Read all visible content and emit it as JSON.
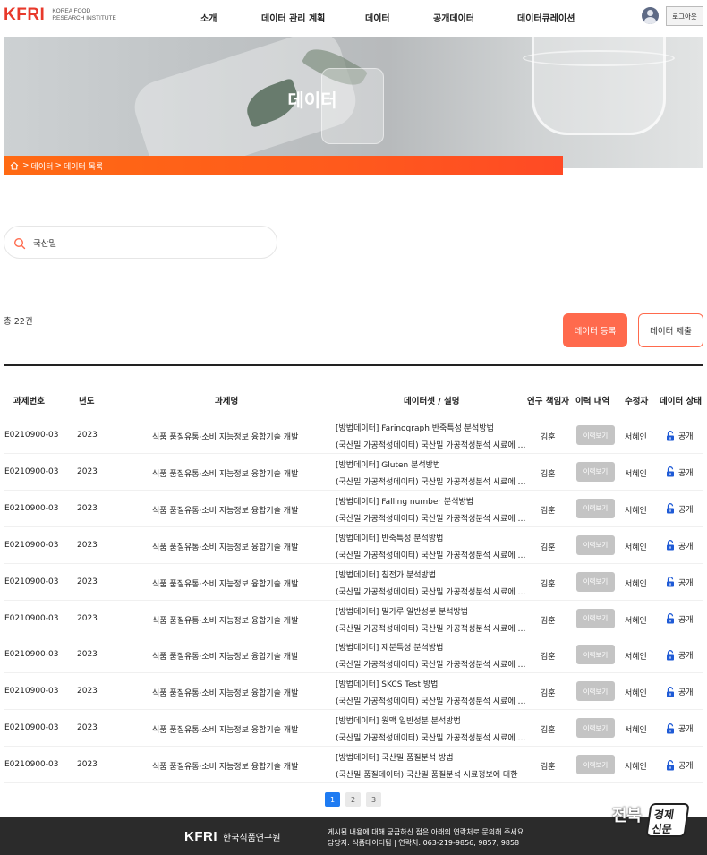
{
  "header": {
    "logo_mark": "KFRI",
    "logo_sub_line1": "KOREA FOOD",
    "logo_sub_line2": "RESEARCH INSTITUTE",
    "nav": [
      "소개",
      "데이터 관리 계획",
      "데이터",
      "공개데이터",
      "데이터큐레이션"
    ],
    "logout_label": "로그아웃"
  },
  "hero": {
    "title": "데이터",
    "breadcrumb": [
      "데이터",
      "데이터 목록"
    ]
  },
  "search": {
    "value": "국산밀",
    "placeholder": ""
  },
  "list": {
    "total": "총 22건",
    "register_label": "데이터 등록",
    "submit_label": "데이터 제출"
  },
  "table": {
    "headers": [
      "과제번호",
      "년도",
      "과제명",
      "데이터셋 / 설명",
      "연구 책임자",
      "이력 내역",
      "수정자",
      "데이터 상태"
    ],
    "history_button": "이력보기",
    "rows": [
      {
        "id": "E0210900-03",
        "year": "2023",
        "project": "식품 품질유통·소비 지능정보 융합기술 개발",
        "title": "[방법데이터] Farinograph 반죽특성 분석방법",
        "desc": "(국산밀 가공적성데이터) 국산밀 가공적성분석 시료에 대한",
        "lead": "김훈",
        "modifier": "서혜인",
        "status": "공개"
      },
      {
        "id": "E0210900-03",
        "year": "2023",
        "project": "식품 품질유통·소비 지능정보 융합기술 개발",
        "title": "[방법데이터] Gluten 분석방법",
        "desc": "(국산밀 가공적성데이터) 국산밀 가공적성분석 시료에 대한",
        "lead": "김훈",
        "modifier": "서혜인",
        "status": "공개"
      },
      {
        "id": "E0210900-03",
        "year": "2023",
        "project": "식품 품질유통·소비 지능정보 융합기술 개발",
        "title": "[방법데이터] Falling number 분석방법",
        "desc": "(국산밀 가공적성데이터) 국산밀 가공적성분석 시료에 대한",
        "lead": "김훈",
        "modifier": "서혜인",
        "status": "공개"
      },
      {
        "id": "E0210900-03",
        "year": "2023",
        "project": "식품 품질유통·소비 지능정보 융합기술 개발",
        "title": "[방법데이터] 반죽특성 분석방법",
        "desc": "(국산밀 가공적성데이터) 국산밀 가공적성분석 시료에 대한",
        "lead": "김훈",
        "modifier": "서혜인",
        "status": "공개"
      },
      {
        "id": "E0210900-03",
        "year": "2023",
        "project": "식품 품질유통·소비 지능정보 융합기술 개발",
        "title": "[방법데이터] 침전가 분석방법",
        "desc": "(국산밀 가공적성데이터) 국산밀 가공적성분석 시료에 대한",
        "lead": "김훈",
        "modifier": "서혜인",
        "status": "공개"
      },
      {
        "id": "E0210900-03",
        "year": "2023",
        "project": "식품 품질유통·소비 지능정보 융합기술 개발",
        "title": "[방법데이터] 밀가루 일반성분 분석방법",
        "desc": "(국산밀 가공적성데이터) 국산밀 가공적성분석 시료에 대한",
        "lead": "김훈",
        "modifier": "서혜인",
        "status": "공개"
      },
      {
        "id": "E0210900-03",
        "year": "2023",
        "project": "식품 품질유통·소비 지능정보 융합기술 개발",
        "title": "[방법데이터] 제분특성 분석방법",
        "desc": "(국산밀 가공적성데이터) 국산밀 가공적성분석 시료에 대한",
        "lead": "김훈",
        "modifier": "서혜인",
        "status": "공개"
      },
      {
        "id": "E0210900-03",
        "year": "2023",
        "project": "식품 품질유통·소비 지능정보 융합기술 개발",
        "title": "[방법데이터] SKCS Test 방법",
        "desc": "(국산밀 가공적성데이터) 국산밀 가공적성분석 시료에 대한",
        "lead": "김훈",
        "modifier": "서혜인",
        "status": "공개"
      },
      {
        "id": "E0210900-03",
        "year": "2023",
        "project": "식품 품질유통·소비 지능정보 융합기술 개발",
        "title": "[방법데이터] 원맥 일반성분 분석방법",
        "desc": "(국산밀 가공적성데이터) 국산밀 가공적성분석 시료에 대한",
        "lead": "김훈",
        "modifier": "서혜인",
        "status": "공개"
      },
      {
        "id": "E0210900-03",
        "year": "2023",
        "project": "식품 품질유통·소비 지능정보 융합기술 개발",
        "title": "[방법데이터] 국산밀 품질분석 방법",
        "desc": "(국산밀 품질데이터) 국산밀 품질분석 시료정보에 대한",
        "lead": "김훈",
        "modifier": "서혜인",
        "status": "공개"
      }
    ]
  },
  "pagination": {
    "pages": [
      "1",
      "2",
      "3"
    ],
    "current": "1"
  },
  "footer": {
    "logo_mark": "KFRI",
    "org_name": "한국식품연구원",
    "line1": "게시된 내용에 대해 궁금하신 점은 아래의 연락처로 문의해 주세요.",
    "line2": "담당자: 식품데이터팀 | 연락처: 063-219-9856, 9857, 9858"
  },
  "watermark": {
    "text_a": "전북",
    "text_b1": "경제",
    "text_b2": "신문"
  },
  "colors": {
    "brand_red": "#e8392b",
    "accent_orange": "#ff6a13",
    "register_button": "#ff6a4d",
    "page_active": "#1e7bf2",
    "status_lock": "#1e5ad6",
    "footer_bg": "#2b2b2b"
  },
  "icons": {
    "home": "home-icon",
    "search": "search-icon",
    "lock": "unlock-icon",
    "avatar": "user-avatar-icon"
  }
}
